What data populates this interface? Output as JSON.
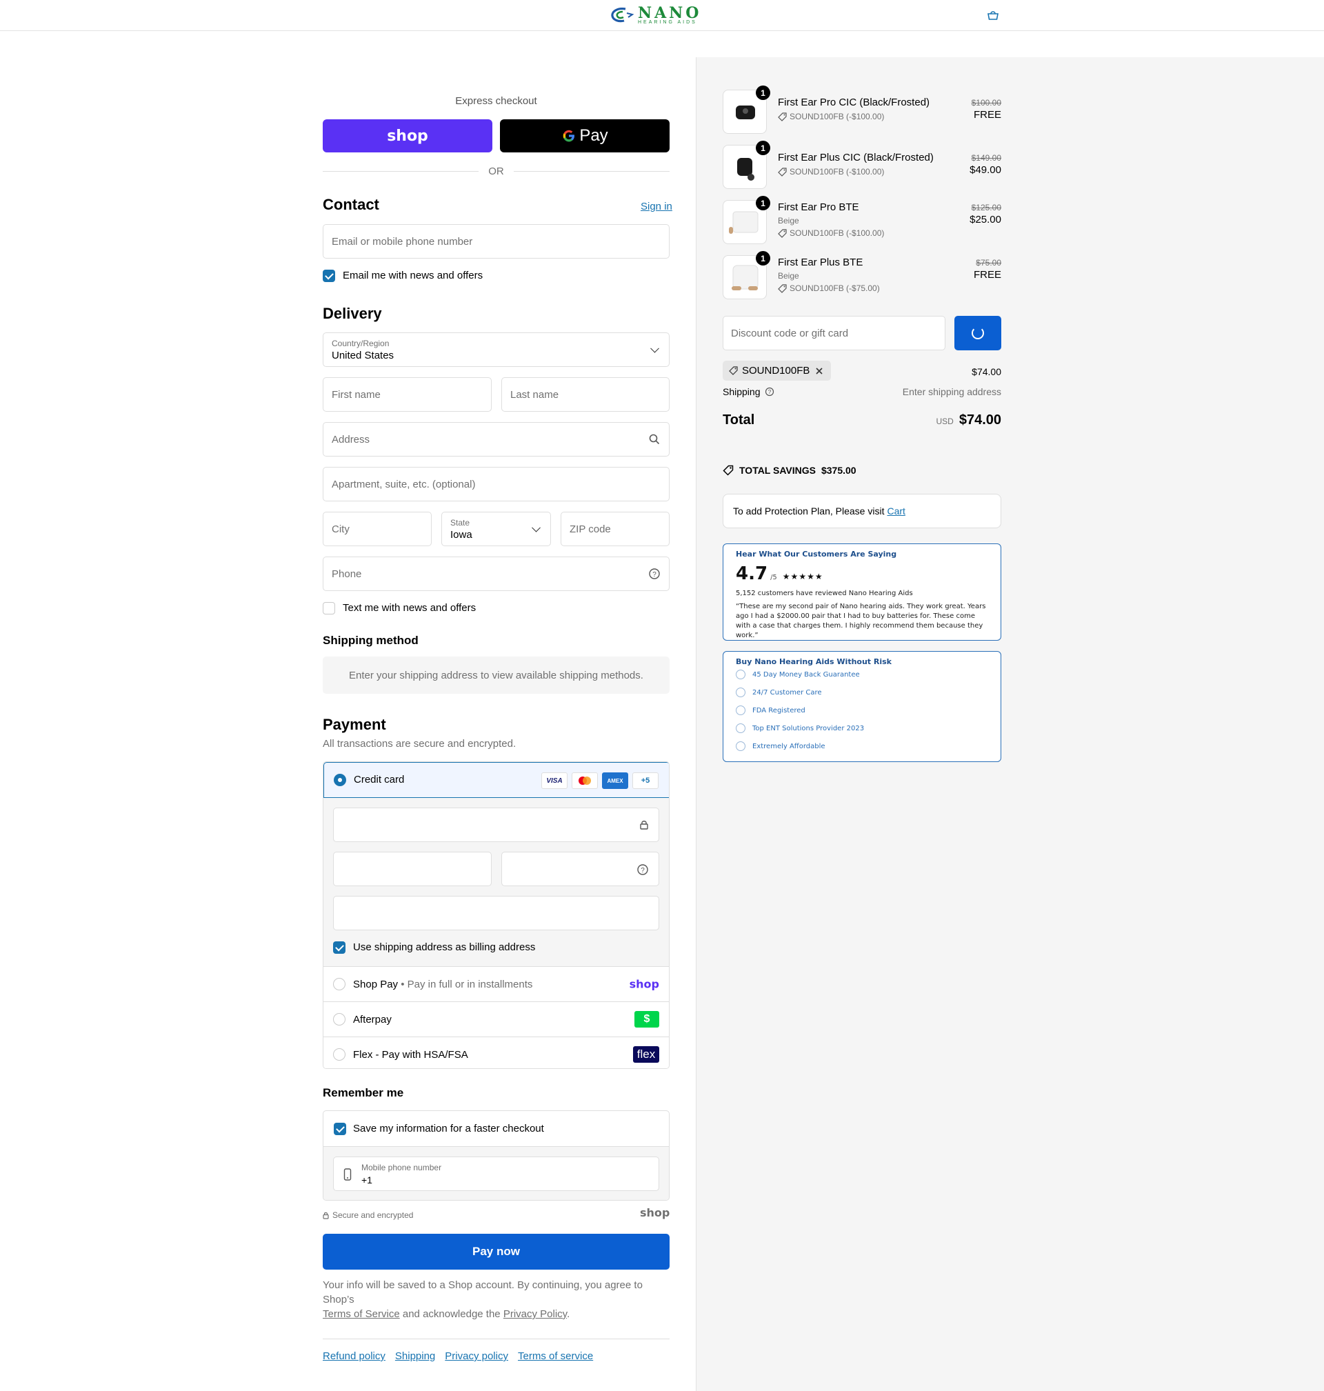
{
  "brand": {
    "name": "NANO",
    "sub": "HEARING AIDS",
    "color": "#1d8a3a"
  },
  "express": {
    "label": "Express checkout",
    "shop_label": "shop",
    "gpay_label": "Pay",
    "or": "OR"
  },
  "contact": {
    "heading": "Contact",
    "sign_in": "Sign in",
    "email_placeholder": "Email or mobile phone number",
    "news_label": "Email me with news and offers"
  },
  "delivery": {
    "heading": "Delivery",
    "country_label": "Country/Region",
    "country_value": "United States",
    "first_name": "First name",
    "last_name": "Last name",
    "address": "Address",
    "apartment": "Apartment, suite, etc. (optional)",
    "city": "City",
    "state_label": "State",
    "state_value": "Iowa",
    "zip": "ZIP code",
    "phone": "Phone",
    "text_label": "Text me with news and offers"
  },
  "shipping_method": {
    "heading": "Shipping method",
    "message": "Enter your shipping address to view available shipping methods."
  },
  "payment": {
    "heading": "Payment",
    "subtitle": "All transactions are secure and encrypted.",
    "credit_card": "Credit card",
    "cards": [
      "VISA",
      "MC",
      "AMEX"
    ],
    "more_cards": "+5",
    "billing_label": "Use shipping address as billing address",
    "shop_pay": "Shop Pay",
    "shop_pay_sub": "Pay in full or in installments",
    "shop_badge": "shop",
    "afterpay": "Afterpay",
    "afterpay_badge": "$",
    "flex": "Flex - Pay with HSA/FSA",
    "flex_badge": "flex"
  },
  "remember": {
    "heading": "Remember me",
    "save_label": "Save my information for a faster checkout",
    "mobile_label": "Mobile phone number",
    "mobile_value": "+1",
    "secure": "Secure and encrypted",
    "shop": "shop"
  },
  "pay_now": "Pay now",
  "legal": {
    "text1": "Your info will be saved to a Shop account. By continuing, you agree to Shop’s",
    "tos": "Terms of Service",
    "text2": "and acknowledge the",
    "privacy": "Privacy Policy",
    "end": "."
  },
  "footer": [
    "Refund policy",
    "Shipping",
    "Privacy policy",
    "Terms of service"
  ],
  "items": [
    {
      "name": "First Ear Pro CIC (Black/Frosted)",
      "variant": "",
      "qty": "1",
      "discount": "SOUND100FB (-$100.00)",
      "old": "$100.00",
      "price": "FREE"
    },
    {
      "name": "First Ear Plus CIC (Black/Frosted)",
      "variant": "",
      "qty": "1",
      "discount": "SOUND100FB (-$100.00)",
      "old": "$149.00",
      "price": "$49.00"
    },
    {
      "name": "First Ear Pro BTE",
      "variant": "Beige",
      "qty": "1",
      "discount": "SOUND100FB (-$100.00)",
      "old": "$125.00",
      "price": "$25.00"
    },
    {
      "name": "First Ear Plus BTE",
      "variant": "Beige",
      "qty": "1",
      "discount": "SOUND100FB (-$75.00)",
      "old": "$75.00",
      "price": "FREE"
    }
  ],
  "summary": {
    "discount_placeholder": "Discount code or gift card",
    "code": "SOUND100FB",
    "subtotal": "$74.00",
    "shipping_label": "Shipping",
    "shipping_value": "Enter shipping address",
    "total_label": "Total",
    "currency": "USD",
    "total": "$74.00",
    "savings_label": "TOTAL SAVINGS",
    "savings_value": "$375.00",
    "protection": "To add Protection Plan, Please visit",
    "protection_link": "Cart"
  },
  "reviews": {
    "title": "Hear What Our Customers Are Saying",
    "rating": "4.7",
    "scale": "/5",
    "stars": "★★★★★",
    "count": "5,152 customers have reviewed Nano Hearing Aids",
    "quote": "“These are my second pair of Nano hearing aids. They work great. Years ago I had a $2000.00 pair that I had to buy batteries for. These come with a case that charges them. I highly recommend them because they work.”"
  },
  "risk": {
    "title": "Buy Nano Hearing Aids Without Risk",
    "items": [
      "45 Day Money Back Guarantee",
      "24/7 Customer Care",
      "FDA Registered",
      "Top ENT Solutions Provider 2023",
      "Extremely Affordable"
    ]
  }
}
